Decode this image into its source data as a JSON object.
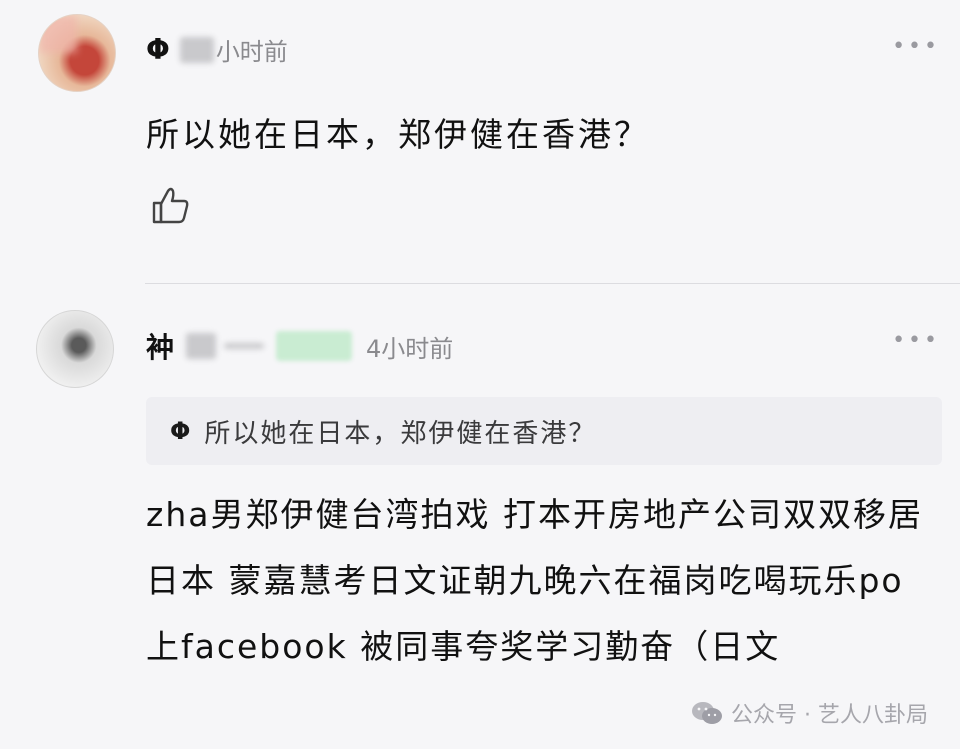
{
  "comments": [
    {
      "name": "Φ",
      "time": "小时前",
      "text": "所以她在日本，郑伊健在香港？",
      "like_icon": "thumbs-up-icon",
      "more_icon": "more-dots-icon"
    },
    {
      "name": "衶",
      "time": "4小时前",
      "quote_name": "Φ",
      "quote_text": "所以她在日本，郑伊健在香港？",
      "text": "zha男郑伊健台湾拍戏 打本开房地产公司双双移居日本 蒙嘉慧考日文证朝九晚六在福岗吃喝玩乐po上facebook 被同事夸奖学习勤奋（日文",
      "more_icon": "more-dots-icon"
    }
  ],
  "watermark": {
    "text": "公众号 · 艺人八卦局",
    "icon": "wechat-icon"
  }
}
